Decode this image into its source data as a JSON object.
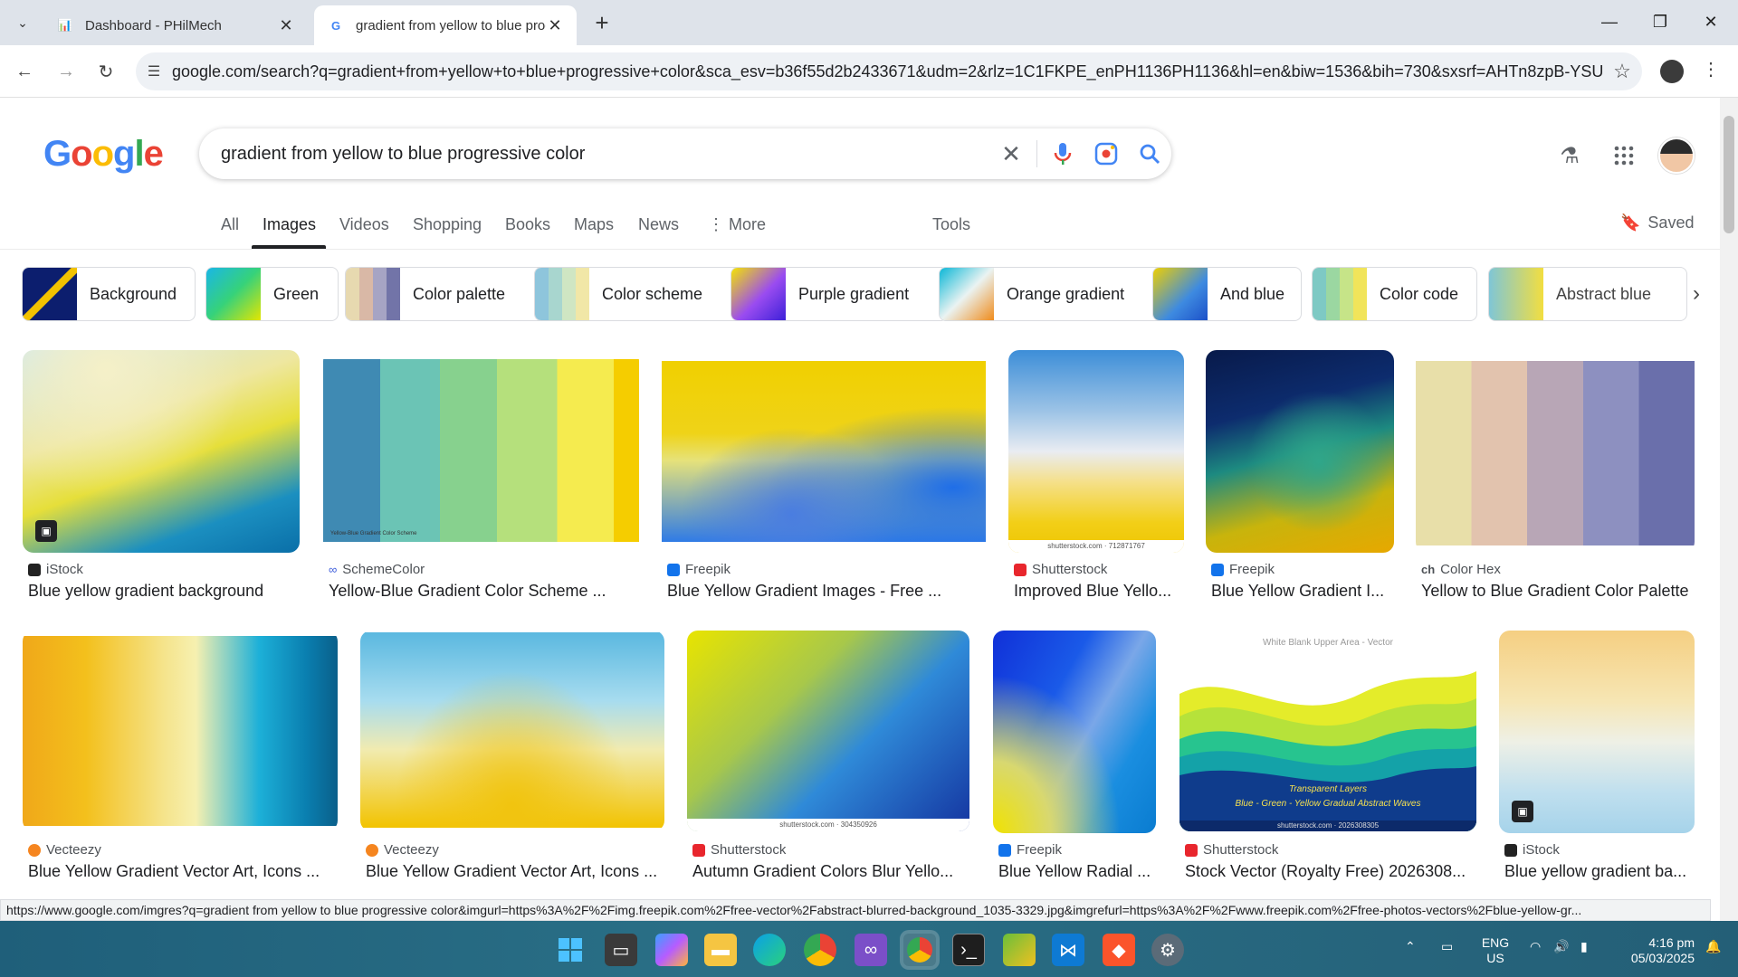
{
  "browser": {
    "tabs": [
      {
        "title": "Dashboard - PHilMech",
        "active": false
      },
      {
        "title": "gradient from yellow to blue progressive color - Google Search",
        "active": true
      }
    ],
    "url": "google.com/search?q=gradient+from+yellow+to+blue+progressive+color&sca_esv=b36f55d2b2433671&udm=2&rlz=1C1FKPE_enPH1136PH1136&hl=en&biw=1536&bih=730&sxsrf=AHTn8zpB-YSU...",
    "status_url": "https://www.google.com/imgres?q=gradient from yellow to blue progressive color&imgurl=https%3A%2F%2Fimg.freepik.com%2Ffree-vector%2Fabstract-blurred-background_1035-3329.jpg&imgrefurl=https%3A%2F%2Fwww.freepik.com%2Ffree-photos-vectors%2Fblue-yellow-gr..."
  },
  "google": {
    "logo": "Google",
    "query": "gradient from yellow to blue progressive color",
    "tabs": [
      "All",
      "Images",
      "Videos",
      "Shopping",
      "Books",
      "Maps",
      "News",
      "More",
      "Tools"
    ],
    "saved_label": "Saved",
    "chips": [
      "Background",
      "Green",
      "Color palette",
      "Color scheme",
      "Purple gradient",
      "Orange gradient",
      "And blue",
      "Color code",
      "Abstract blue"
    ],
    "results_row1": [
      {
        "source": "iStock",
        "title": "Blue yellow gradient background"
      },
      {
        "source": "SchemeColor",
        "title": "Yellow-Blue Gradient Color Scheme ..."
      },
      {
        "source": "Freepik",
        "title": "Blue Yellow Gradient Images - Free ..."
      },
      {
        "source": "Shutterstock",
        "title": "Improved Blue Yello..."
      },
      {
        "source": "Freepik",
        "title": "Blue Yellow Gradient I..."
      },
      {
        "source": "Color Hex",
        "title": "Yellow to Blue Gradient Color Palette"
      }
    ],
    "results_row2": [
      {
        "source": "Vecteezy",
        "title": "Blue Yellow Gradient Vector Art, Icons ..."
      },
      {
        "source": "Vecteezy",
        "title": "Blue Yellow Gradient Vector Art, Icons ..."
      },
      {
        "source": "Shutterstock",
        "title": "Autumn Gradient Colors Blur Yello..."
      },
      {
        "source": "Freepik",
        "title": "Blue Yellow Radial ..."
      },
      {
        "source": "Shutterstock",
        "title": "Stock Vector (Royalty Free) 2026308..."
      },
      {
        "source": "iStock",
        "title": "Blue yellow gradient ba..."
      }
    ],
    "image_captions": {
      "scheme_hexes": [
        "#3F8AB3",
        "#6BC4B5",
        "#87D18E",
        "#B5E07C",
        "#F5EB4F",
        "#F5CD00"
      ],
      "scheme_caption": "Yellow-Blue Gradient Color Scheme",
      "shutterstock_1": "shutterstock.com · 712871767",
      "shutterstock_2": "shutterstock.com · 304350926",
      "shutterstock_3": "shutterstock.com · 2026308305",
      "waves_top": "White Blank Upper Area - Vector",
      "waves_bottom_1": "Transparent Layers",
      "waves_bottom_2": "Blue - Green - Yellow Gradual Abstract Waves"
    }
  },
  "taskbar": {
    "lang_1": "ENG",
    "lang_2": "US",
    "time": "4:16 pm",
    "date": "05/03/2025"
  }
}
